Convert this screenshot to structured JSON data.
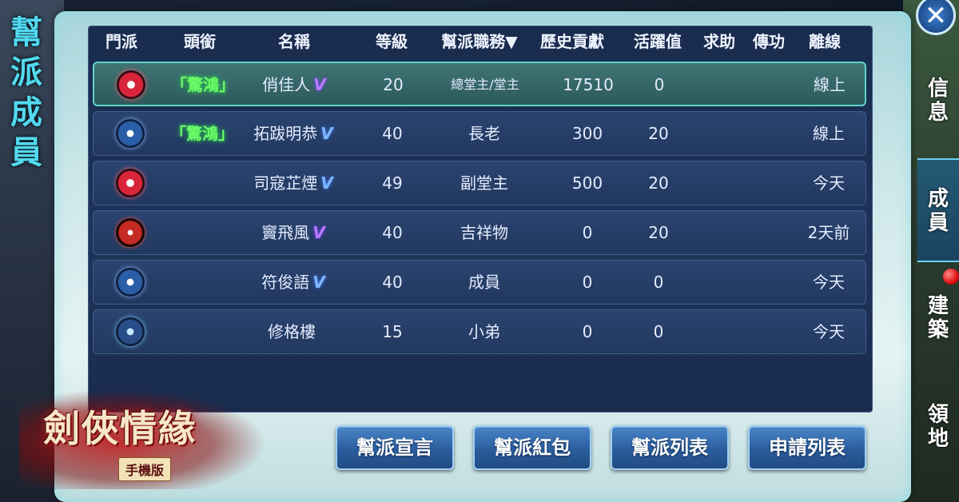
{
  "panel_title": [
    "幫",
    "派",
    "成",
    "員"
  ],
  "headers": {
    "sect": "門派",
    "title": "頭銜",
    "name": "名稱",
    "level": "等級",
    "duty": "幫派職務▼",
    "contribution": "歷史貢獻",
    "activity": "活躍值",
    "help": "求助",
    "pass": "傳功",
    "offline": "離線"
  },
  "members": [
    {
      "sect_icon": "flower-sect-icon",
      "title": "「驚鴻」",
      "name": "俏佳人",
      "vip": "V",
      "level": "20",
      "duty": "總堂主/堂主",
      "contribution": "17510",
      "activity": "0",
      "help": "",
      "pass": "",
      "offline": "線上",
      "selected": true
    },
    {
      "sect_icon": "taiji-sect-icon",
      "title": "「驚鴻」",
      "name": "拓跋明恭",
      "vip": "V",
      "level": "40",
      "duty": "長老",
      "contribution": "300",
      "activity": "20",
      "help": "",
      "pass": "",
      "offline": "線上",
      "selected": false
    },
    {
      "sect_icon": "flower-sect-icon",
      "title": "",
      "name": "司寇芷煙",
      "vip": "V",
      "level": "49",
      "duty": "副堂主",
      "contribution": "500",
      "activity": "20",
      "help": "",
      "pass": "",
      "offline": "今天",
      "selected": false
    },
    {
      "sect_icon": "blade-sect-icon",
      "title": "",
      "name": "竇飛風",
      "vip": "V",
      "level": "40",
      "duty": "吉祥物",
      "contribution": "0",
      "activity": "20",
      "help": "",
      "pass": "",
      "offline": "2天前",
      "selected": false
    },
    {
      "sect_icon": "taiji-sect-icon",
      "title": "",
      "name": "符俊語",
      "vip": "V",
      "level": "40",
      "duty": "成員",
      "contribution": "0",
      "activity": "0",
      "help": "",
      "pass": "",
      "offline": "今天",
      "selected": false
    },
    {
      "sect_icon": "lotus-sect-icon",
      "title": "",
      "name": "修格樓",
      "vip": "",
      "level": "15",
      "duty": "小弟",
      "contribution": "0",
      "activity": "0",
      "help": "",
      "pass": "",
      "offline": "今天",
      "selected": false
    }
  ],
  "buttons": {
    "declaration": "幫派宣言",
    "red_packet": "幫派紅包",
    "guild_list": "幫派列表",
    "apply_list": "申請列表"
  },
  "side_tabs": {
    "info": [
      "信",
      "息"
    ],
    "members": [
      "成",
      "員"
    ],
    "build": [
      "建",
      "築"
    ],
    "territory": [
      "領",
      "地"
    ]
  },
  "close_glyph": "✕",
  "logo": {
    "text": "劍俠情緣",
    "subtitle": "手機版"
  },
  "colors": {
    "title_cyan": "#52d9ef",
    "row_bg": "#22385e",
    "selected_row_bg": "#2d5a5c",
    "title_green": "#6dfa6a",
    "vip_purple": "#b87cff",
    "button_blue": "#2a5d9e"
  }
}
